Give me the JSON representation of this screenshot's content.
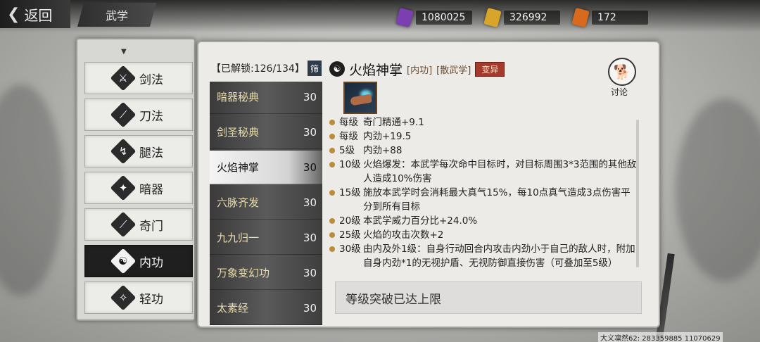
{
  "header": {
    "back_label": "返回",
    "section_title": "武学"
  },
  "currencies": [
    {
      "value": "1080025",
      "color": "#7b3fb0"
    },
    {
      "value": "326992",
      "color": "#d8a42a"
    },
    {
      "value": "172",
      "color": "#d86a1e"
    }
  ],
  "categories": [
    {
      "label": "剑法",
      "icon": "sword-icon"
    },
    {
      "label": "刀法",
      "icon": "blade-icon"
    },
    {
      "label": "腿法",
      "icon": "kick-icon"
    },
    {
      "label": "暗器",
      "icon": "shuriken-icon"
    },
    {
      "label": "奇门",
      "icon": "staff-icon"
    },
    {
      "label": "内功",
      "icon": "meditation-icon",
      "active": true
    },
    {
      "label": "轻功",
      "icon": "lightness-icon"
    }
  ],
  "skill_list": {
    "unlock_label": "【已解锁:126/134】",
    "filter_label": "筛",
    "items": [
      {
        "name": "暗器秘典",
        "level": "30"
      },
      {
        "name": "剑圣秘典",
        "level": "30"
      },
      {
        "name": "火焰神掌",
        "level": "30",
        "active": true
      },
      {
        "name": "六脉齐发",
        "level": "30"
      },
      {
        "name": "九九归一",
        "level": "30"
      },
      {
        "name": "万象变幻功",
        "level": "30"
      },
      {
        "name": "太素经",
        "level": "30"
      }
    ]
  },
  "skill": {
    "name": "火焰神掌",
    "tag1": "[内功]",
    "tag2": "[散武学]",
    "mutate_label": "变异",
    "discuss_label": "讨论",
    "effects": [
      {
        "lv": "每级",
        "text": "奇门精通+9.1"
      },
      {
        "lv": "每级",
        "text": "内劲+19.5"
      },
      {
        "lv": "5级",
        "text": "内劲+88"
      },
      {
        "lv": "10级",
        "text": "火焰爆发：本武学每次命中目标时，对目标周围3*3范围的其他敌人造成10%伤害"
      },
      {
        "lv": "15级",
        "text": "施放本武学时会消耗最大真气15%，每10点真气造成3点伤害平分到所有目标"
      },
      {
        "lv": "20级",
        "text": "本武学威力百分比+24.0%"
      },
      {
        "lv": "25级",
        "text": "火焰的攻击次数+2"
      },
      {
        "lv": "30级",
        "text": "由内及外1级：自身行动回合内攻击内劲小于自己的敌人时，附加自身内劲*1的无视护盾、无视防御直接伤害（可叠加至5级）"
      }
    ],
    "limit_text": "等级突破已达上限"
  },
  "watermark": "大义凛然62: 283359885  11070629"
}
